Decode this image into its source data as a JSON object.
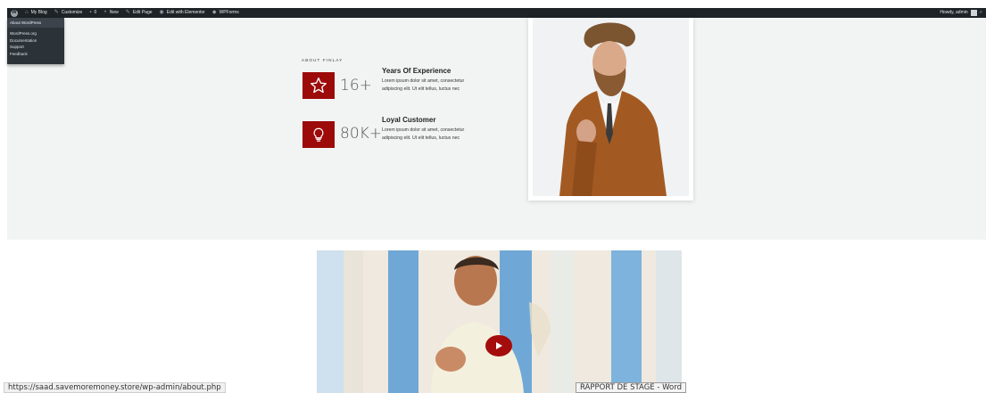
{
  "adminbar": {
    "items": [
      {
        "icon": "home-icon",
        "label": "My Blog"
      },
      {
        "icon": "brush-icon",
        "label": "Customize"
      },
      {
        "icon": "comment-icon",
        "label": "0"
      },
      {
        "icon": "plus-icon",
        "label": "New"
      },
      {
        "icon": "pencil-icon",
        "label": "Edit Page"
      },
      {
        "icon": "elementor-icon",
        "label": "Edit with Elementor"
      },
      {
        "icon": "diamond-icon",
        "label": "WPForms"
      }
    ],
    "account_label": "Howdy, admin"
  },
  "wp_menu": {
    "top_item": "About WordPress",
    "sub_items": [
      "WordPress.org",
      "Documentation",
      "Support",
      "Feedback"
    ]
  },
  "about": {
    "eyebrow": "ABOUT FINLAY",
    "features": [
      {
        "icon": "star-icon",
        "number": "16+",
        "title": "Years Of Experience",
        "text": "Lorem ipsum dolor sit amet, consectetur adipiscing elit. Ut elit tellus, luctus nec"
      },
      {
        "icon": "lightbulb-icon",
        "number": "80K+",
        "title": "Loyal Customer",
        "text": "Lorem ipsum dolor sit amet, consectetur adipiscing elit. Ut elit tellus, luctus nec"
      }
    ]
  },
  "video": {
    "play_icon": "play-icon"
  },
  "status_bar": {
    "url": "https://saad.savemoremoney.store/wp-admin/about.php"
  },
  "taskbar_tooltip": "RAPPORT DE STAGE - Word",
  "colors": {
    "accent": "#9c0a0a",
    "adminbar": "#1d2327",
    "section_bg": "#f2f4f4"
  }
}
